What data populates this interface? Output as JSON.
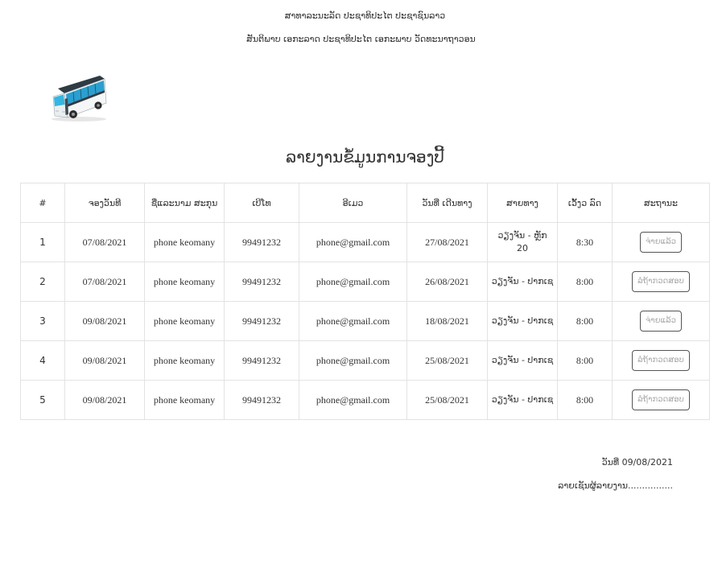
{
  "header": {
    "line1": "ສາທາລະນະລັດ ປະຊາທິປະໄຕ ປະຊາຊົນລາວ",
    "line2": "ສັນຕິພາບ ເອກະລາດ ປະຊາທິປະໄຕ ເອກະພາບ ວັດທະນາຖາວອນ"
  },
  "logo": {
    "icon": "bus-icon"
  },
  "report": {
    "title": "ລາຍງານຂໍ້ມູນການຈອງປີ້"
  },
  "table": {
    "headers": {
      "index": "#",
      "booking_date": "ຈອງວັນທີ",
      "name": "ຊື່ແລະນາມ ສະກຸນ",
      "phone": "ເບີໂທ",
      "email": "ອີເມວ",
      "travel_date": "ວັນທີ່ ເດີນທາງ",
      "route": "ສາຍທາງ",
      "departure_time": "ເວັ້ງວ ລົດ",
      "status": "ສະຖານະ"
    },
    "rows": [
      {
        "index": "1",
        "booking_date": "07/08/2021",
        "name": "phone keomany",
        "phone": "99491232",
        "email": "phone@gmail.com",
        "travel_date": "27/08/2021",
        "route": "ວຽງຈັນ - ຫຼັກ 20",
        "departure_time": "8:30",
        "status": "ຈ່າຍແລ້ວ"
      },
      {
        "index": "2",
        "booking_date": "07/08/2021",
        "name": "phone keomany",
        "phone": "99491232",
        "email": "phone@gmail.com",
        "travel_date": "26/08/2021",
        "route": "ວຽງຈັນ - ປາກເຊ",
        "departure_time": "8:00",
        "status": "ລໍຖ້າກວດສອບ"
      },
      {
        "index": "3",
        "booking_date": "09/08/2021",
        "name": "phone keomany",
        "phone": "99491232",
        "email": "phone@gmail.com",
        "travel_date": "18/08/2021",
        "route": "ວຽງຈັນ - ປາກເຊ",
        "departure_time": "8:00",
        "status": "ຈ່າຍແລ້ວ"
      },
      {
        "index": "4",
        "booking_date": "09/08/2021",
        "name": "phone keomany",
        "phone": "99491232",
        "email": "phone@gmail.com",
        "travel_date": "25/08/2021",
        "route": "ວຽງຈັນ - ປາກເຊ",
        "departure_time": "8:00",
        "status": "ລໍຖ້າກວດສອບ"
      },
      {
        "index": "5",
        "booking_date": "09/08/2021",
        "name": "phone keomany",
        "phone": "99491232",
        "email": "phone@gmail.com",
        "travel_date": "25/08/2021",
        "route": "ວຽງຈັນ - ປາກເຊ",
        "departure_time": "8:00",
        "status": "ລໍຖ້າກວດສອບ"
      }
    ]
  },
  "footer": {
    "date": "ວັນທີ່ 09/08/2021",
    "signature": "ລາຍເຊັນຜູ້ລາຍງານ................"
  }
}
